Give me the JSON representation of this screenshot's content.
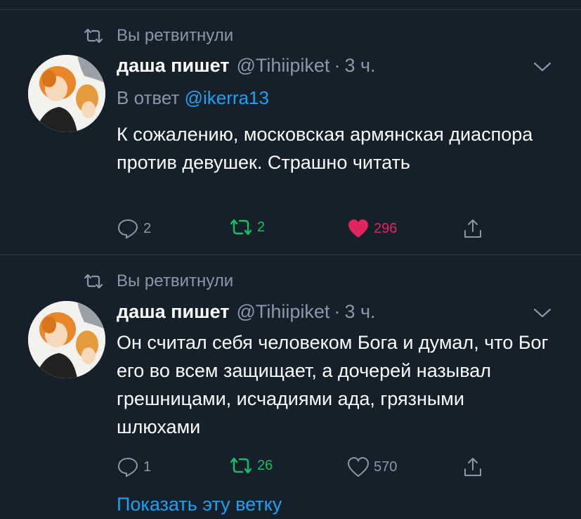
{
  "tweets": [
    {
      "retweet_label": "Вы ретвитнули",
      "author_name": "даша пишет",
      "handle": "@Tihiipiket",
      "dot": "·",
      "time": "3 ч.",
      "reply_prefix": "В ответ",
      "reply_mention": "@ikerra13",
      "body": "К сожалению, московская армянская диаспора против девушек. Страшно читать",
      "replies": "2",
      "retweets": "2",
      "likes": "296",
      "liked": true,
      "retweeted": true
    },
    {
      "retweet_label": "Вы ретвитнули",
      "author_name": "даша пишет",
      "handle": "@Tihiipiket",
      "dot": "·",
      "time": "3 ч.",
      "body": "Он считал себя человеком Бога и думал, что Бог его во всем защищает, а дочерей называл грешницами, исчадиями ада, грязными шлюхами",
      "replies": "1",
      "retweets": "26",
      "likes": "570",
      "liked": false,
      "retweeted": true,
      "show_thread": "Показать эту ветку"
    }
  ],
  "colors": {
    "background": "#15202b",
    "secondary_text": "#8899a6",
    "accent_blue": "#1da1f2",
    "retweet_green": "#17bf63",
    "like_red": "#e0245e"
  },
  "icons": [
    "retweet-icon",
    "chevron-down-icon",
    "reply-icon",
    "like-icon",
    "share-icon",
    "avatar"
  ]
}
